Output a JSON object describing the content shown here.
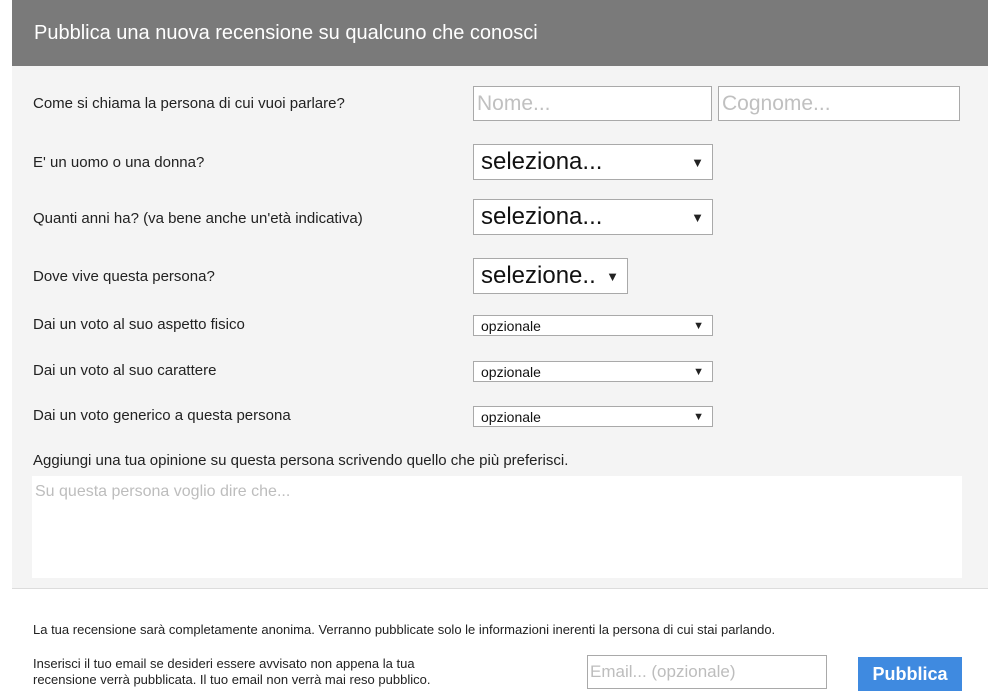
{
  "header": {
    "title": "Pubblica una nuova recensione su qualcuno che conosci"
  },
  "form": {
    "name": {
      "label": "Come si chiama la persona di cui vuoi parlare?",
      "first_placeholder": "Nome...",
      "last_placeholder": "Cognome..."
    },
    "gender": {
      "label": "E' un uomo o una donna?",
      "value": "seleziona..."
    },
    "age": {
      "label": "Quanti anni ha? (va bene anche un'età indicativa)",
      "value": "seleziona..."
    },
    "location": {
      "label": "Dove vive questa persona?",
      "value": "selezione.."
    },
    "physical": {
      "label": "Dai un voto al suo aspetto fisico",
      "value": "opzionale"
    },
    "character": {
      "label": "Dai un voto al suo carattere",
      "value": "opzionale"
    },
    "general": {
      "label": "Dai un voto generico a questa persona",
      "value": "opzionale"
    },
    "opinion": {
      "label": "Aggiungi una tua opinione su questa persona scrivendo quello che più preferisci.",
      "placeholder": "Su questa persona voglio dire che..."
    }
  },
  "footer": {
    "anonymous_note": "La tua recensione sarà completamente anonima. Verranno pubblicate solo le informazioni inerenti la persona di cui stai parlando.",
    "email_note_line1": "Inserisci il tuo email se desideri essere avvisato non appena la tua",
    "email_note_line2": "recensione verrà pubblicata. Il tuo email non verrà mai reso pubblico.",
    "email_placeholder": "Email... (opzionale)",
    "publish_label": "Pubblica"
  },
  "icons": {
    "dropdown": "triangle-down-icon",
    "caret_glyph": "▼"
  },
  "colors": {
    "header_bg": "#7a7a7a",
    "panel_bg": "#f4f4f4",
    "button_bg": "#3f8ae0"
  }
}
